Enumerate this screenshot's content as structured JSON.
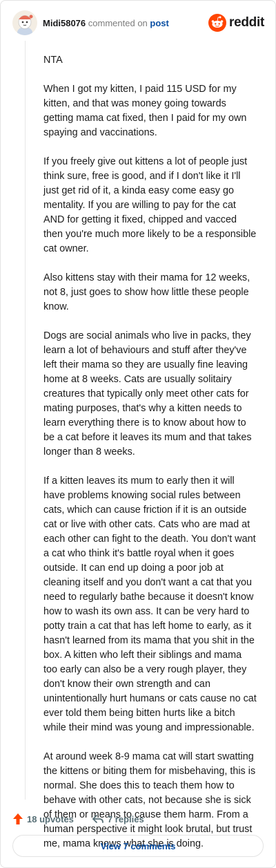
{
  "comment": {
    "author": "Midi58076",
    "action_text": "commented on",
    "post_link": "post",
    "paragraphs": [
      "NTA",
      "When I got my kitten, I paid 115 USD for my kitten, and that was money going towards getting mama cat fixed, then I paid for my own spaying and vaccinations.",
      "If you freely give out kittens a lot of people just think sure, free is good, and if I don't like it I'll just get rid of it, a kinda easy come easy go mentality. If you are willing to pay for the cat AND for getting it fixed, chipped and vacced then you're much more likely to be a responsible cat owner.",
      "Also kittens stay with their mama for 12 weeks, not 8, just goes to show how little these people know.",
      "Dogs are social animals who live in packs, they learn a lot of behaviours and stuff after they've left their mama so they are usually fine leaving home at 8 weeks. Cats are usually solitairy creatures that typically only meet other cats for mating purposes, that's why a kitten needs to learn everything there is to know about how to be a cat before it leaves its mum and that takes longer than 8 weeks.",
      "If a kitten leaves its mum to early then it will have problems knowing social rules between cats, which can cause friction if it is an outside cat or live with other cats. Cats who are mad at each other can fight to the death. You don't want a cat who think it's battle royal when it goes outside. It can end up doing a poor job at cleaning itself and you don't want a cat that you need to regularly bathe because it doesn't know how to wash its own ass. It can be very hard to potty train a cat that has left home to early, as it hasn't learned from its mama that you shit in the box. A kitten who left their siblings and mama too early can also be a very rough player, they don't know their own strength and can unintentionally hurt humans or cats cause no cat ever told them being bitten hurts like a bitch while their mind was young and impressionable.",
      "At around week 8-9 mama cat will start swatting the kittens or biting them for misbehaving, this is normal. She does this to teach them how to behave with other cats, not because she is sick of them or means to cause them harm. From a human perspective it might look brutal, but trust me, mama knows what she is doing."
    ],
    "upvotes_label": "18 upvotes",
    "replies_label": "7 replies",
    "view_comments_label": "View 7 comments"
  },
  "brand": {
    "logo_text": "reddit",
    "brand_color": "#ff4500",
    "link_color": "#0a4fa3",
    "upvote_color": "#ff4500"
  },
  "icons": [
    "avatar",
    "reddit-logo-icon",
    "upvote-arrow-icon",
    "reply-arrow-icon"
  ]
}
